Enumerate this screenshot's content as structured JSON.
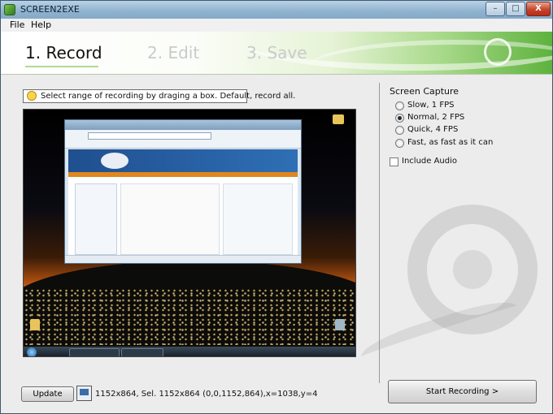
{
  "window": {
    "title": "SCREEN2EXE",
    "controls": {
      "minimize": "–",
      "maximize": "□",
      "close": "X"
    }
  },
  "menu": [
    "File",
    "Help"
  ],
  "steps": [
    "1. Record",
    "2. Edit",
    "3. Save"
  ],
  "hint": "Select range of recording by draging a box. Default, record all.",
  "capture": {
    "title": "Screen Capture",
    "options": [
      {
        "label": "Slow, 1 FPS",
        "checked": false
      },
      {
        "label": "Normal, 2 FPS",
        "checked": true
      },
      {
        "label": "Quick, 4 FPS",
        "checked": false
      },
      {
        "label": "Fast, as fast as it can",
        "checked": false
      }
    ],
    "include_audio": {
      "label": "Include Audio",
      "checked": false
    }
  },
  "buttons": {
    "update": "Update",
    "start_recording": "Start Recording >"
  },
  "selection_info": "1152x864, Sel. 1152x864 (0,0,1152,864),x=1038,y=4",
  "icons": {
    "app": "screen2exe-app-icon",
    "hint": "lightbulb-icon",
    "monitor": "monitor-icon"
  }
}
